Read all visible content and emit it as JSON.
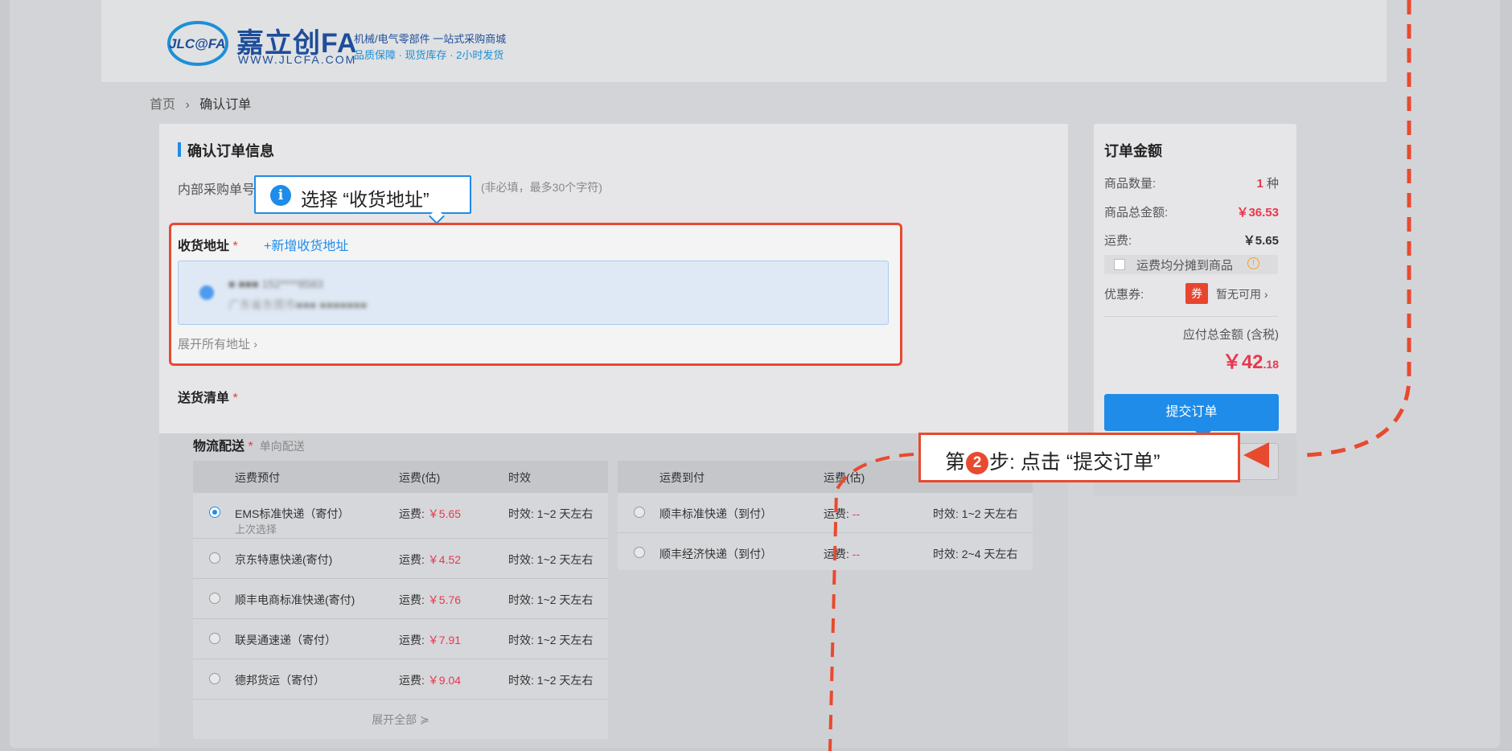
{
  "header": {
    "logo_mark": "JLC@FA",
    "logo_cn": "嘉立创FA",
    "logo_url": "WWW.JLCFA.COM",
    "slogan_line1": "机械/电气零部件  一站式采购商城",
    "slogan_line2": "品质保障 · 现货库存 · 2小时发货"
  },
  "breadcrumb": {
    "home": "首页",
    "separator": "›",
    "current": "确认订单"
  },
  "order_info": {
    "title": "确认订单信息",
    "po_label": "内部采购单号",
    "po_hint": "(非必填，最多30个字符)"
  },
  "tooltip": {
    "icon": "i",
    "text": "选择 “收货地址”"
  },
  "address": {
    "label": "收货地址",
    "required_mark": "*",
    "add_button": "+新增收货地址",
    "blurred_line1": "■ ■■■ 152****8583",
    "blurred_line2": "广东省东莞市■■■ ■■■■■■■",
    "expand": "展开所有地址 ›"
  },
  "shipping": {
    "label": "送货清单",
    "required_mark": "*"
  },
  "logistics": {
    "label": "物流配送",
    "required_mark": "*",
    "sub": "单向配送",
    "prepaid": {
      "headers": [
        "运费预付",
        "运费(估)",
        "时效"
      ],
      "rows": [
        {
          "name": "EMS标准快递（寄付）",
          "note": "上次选择",
          "fee_label": "运费:",
          "fee": "￥5.65",
          "time": "时效: 1~2 天左右",
          "selected": true
        },
        {
          "name": "京东特惠快递(寄付)",
          "fee_label": "运费:",
          "fee": "￥4.52",
          "time": "时效: 1~2 天左右",
          "selected": false
        },
        {
          "name": "顺丰电商标准快递(寄付)",
          "fee_label": "运费:",
          "fee": "￥5.76",
          "time": "时效: 1~2 天左右",
          "selected": false
        },
        {
          "name": "联昊通速递（寄付）",
          "fee_label": "运费:",
          "fee": "￥7.91",
          "time": "时效: 1~2 天左右",
          "selected": false
        },
        {
          "name": "德邦货运（寄付）",
          "fee_label": "运费:",
          "fee": "￥9.04",
          "time": "时效: 1~2 天左右",
          "selected": false
        }
      ],
      "expand_all": "展开全部 ≽"
    },
    "cod": {
      "headers": [
        "运费到付",
        "运费(估)",
        ""
      ],
      "rows": [
        {
          "name": "顺丰标准快递（到付）",
          "fee_label": "运费:",
          "fee": "--",
          "time": "时效: 1~2 天左右"
        },
        {
          "name": "顺丰经济快递（到付）",
          "fee_label": "运费:",
          "fee": "--",
          "time": "时效: 2~4 天左右"
        }
      ]
    }
  },
  "summary": {
    "title": "订单金额",
    "qty_label": "商品数量:",
    "qty_value": "1",
    "qty_unit": "种",
    "goods_label": "商品总金额:",
    "goods_value": "￥36.53",
    "freight_label": "运费:",
    "freight_value": "￥5.65",
    "share_freight": "运费均分摊到商品",
    "warn_icon": "!",
    "coupon_label": "优惠券:",
    "coupon_badge": "券",
    "coupon_value": "暂无可用 ›",
    "payable_label": "应付总金额 (含税)",
    "payable_main": "￥42",
    "payable_decimal": ".18",
    "submit": "提交订单"
  },
  "step_callout": {
    "prefix": "第",
    "num": "2",
    "suffix": "步: 点击 “提交订单”"
  },
  "colors": {
    "accent": "#1e8ce8",
    "annotation_red": "#e84a2f",
    "price_red": "#e8384f"
  }
}
